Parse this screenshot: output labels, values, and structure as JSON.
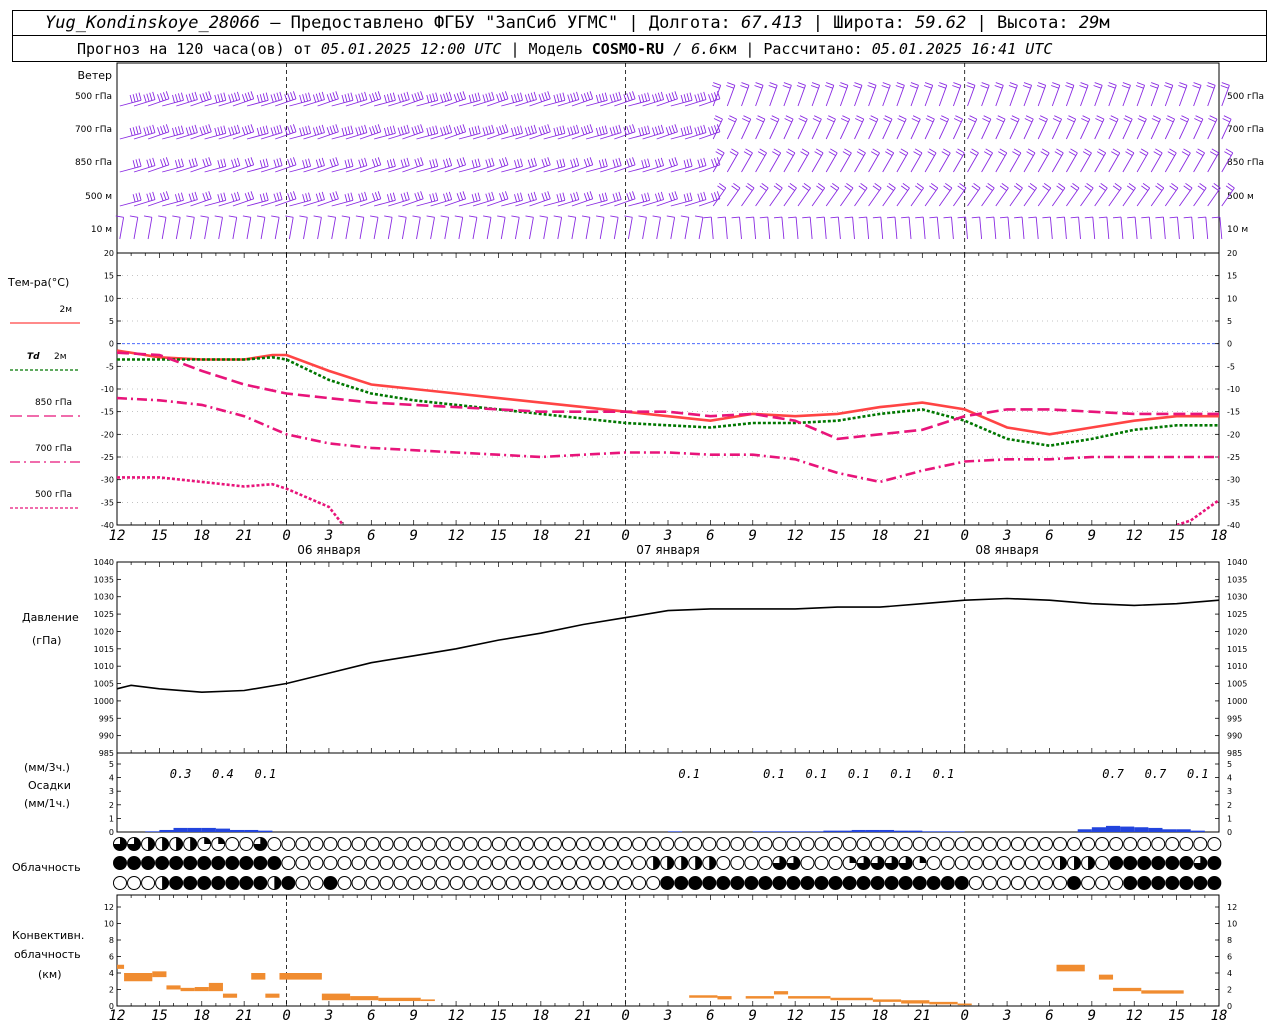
{
  "header": {
    "station": "Yug_Kondinskoye_28066",
    "provided": "– Предоставлено ФГБУ \"ЗапСиб УГМС\"",
    "lon_label": "Долгота:",
    "lon": "67.413",
    "lat_label": "Широта:",
    "lat": "59.62",
    "alt_label": "Высота:",
    "alt": "29",
    "alt_unit": "м",
    "forecast_label": "Прогноз на 120 часа(ов) от",
    "forecast_time": "05.01.2025 12:00 UTC",
    "model_label": "| Модель",
    "model": "COSMO-RU",
    "model_res": "/ 6.6",
    "model_res_unit": "км",
    "calc_label": "| Рассчитано:",
    "calc_time": "05.01.2025 16:41 UTC"
  },
  "wind": {
    "title": "Ветер",
    "levels": [
      "500 гПа",
      "700 гПа",
      "850 гПа",
      "500 м",
      "10  м"
    ],
    "color": "#8a2be2"
  },
  "temp": {
    "title": "Тем-ра(°C)",
    "legend": [
      {
        "prefix": "",
        "label": "2м",
        "color": "#ff4444",
        "dash": ""
      },
      {
        "prefix": "Td",
        "label": "2м",
        "color": "#007700",
        "dash": "3,2"
      },
      {
        "prefix": "",
        "label": "850 гПа",
        "color": "#e8147a",
        "dash": "12,5"
      },
      {
        "prefix": "",
        "label": "700 гПа",
        "color": "#e8147a",
        "dash": "10,4,2,4"
      },
      {
        "prefix": "",
        "label": "500 гПа",
        "color": "#e8147a",
        "dash": "3,2"
      }
    ],
    "ticks": [
      "20",
      "15",
      "10",
      "5",
      "0",
      "-5",
      "-10",
      "-15",
      "-20",
      "-25",
      "-30",
      "-35",
      "-40"
    ]
  },
  "x_axis": {
    "hour_labels": [
      "12",
      "15",
      "18",
      "21",
      "0",
      "3",
      "6",
      "9",
      "12",
      "15",
      "18",
      "21",
      "0",
      "3",
      "6",
      "9",
      "12",
      "15",
      "18",
      "21",
      "0",
      "3",
      "6",
      "9",
      "12",
      "15",
      "18"
    ],
    "dates": [
      "06 января",
      "07 января",
      "08 января"
    ]
  },
  "pressure": {
    "title": "Давление",
    "unit": "(гПа)",
    "ticks": [
      "1040",
      "1035",
      "1030",
      "1025",
      "1020",
      "1015",
      "1010",
      "1005",
      "1000",
      "995",
      "990",
      "985"
    ]
  },
  "precip": {
    "unit_top": "(мм/3ч.)",
    "title": "Осадки",
    "unit_bottom": "(мм/1ч.)",
    "ticks": [
      "5",
      "4",
      "3",
      "2",
      "1",
      "0"
    ],
    "labels": [
      {
        "t": 4.5,
        "text": "0.3"
      },
      {
        "t": 7.5,
        "text": "0.4"
      },
      {
        "t": 10.5,
        "text": "0.1"
      },
      {
        "t": 40.5,
        "text": "0.1"
      },
      {
        "t": 46.5,
        "text": "0.1"
      },
      {
        "t": 49.5,
        "text": "0.1"
      },
      {
        "t": 52.5,
        "text": "0.1"
      },
      {
        "t": 55.5,
        "text": "0.1"
      },
      {
        "t": 58.5,
        "text": "0.1"
      },
      {
        "t": 70.5,
        "text": "0.7"
      },
      {
        "t": 73.5,
        "text": "0.7"
      },
      {
        "t": 76.5,
        "text": "0.1"
      }
    ]
  },
  "cloud": {
    "title": "Облачность"
  },
  "conv": {
    "title1": "Конвективн.",
    "title2": "облачность",
    "unit": "(км)",
    "ticks": [
      "12",
      "10",
      "8",
      "6",
      "4",
      "2",
      "0"
    ]
  },
  "chart_data": [
    {
      "type": "line",
      "title": "Тем-ра(°C)",
      "x_unit": "hours since 05.01.2025 12:00 UTC",
      "ylim": [
        -40,
        20
      ],
      "series": [
        {
          "name": "2м",
          "x": [
            0,
            3,
            6,
            9,
            11,
            12,
            15,
            18,
            21,
            24,
            27,
            30,
            33,
            36,
            39,
            42,
            45,
            48,
            51,
            54,
            57,
            60,
            63,
            66,
            69,
            72,
            75,
            78
          ],
          "values": [
            -1.5,
            -3,
            -3.5,
            -3.5,
            -2.5,
            -2.5,
            -6,
            -9,
            -10,
            -11,
            -12,
            -13,
            -14,
            -15,
            -16,
            -17,
            -15.5,
            -16,
            -15.5,
            -14,
            -13,
            -14.5,
            -18.5,
            -20,
            -18.5,
            -17,
            -16,
            -16
          ]
        },
        {
          "name": "Td 2м",
          "x": [
            0,
            3,
            6,
            9,
            11,
            12,
            15,
            18,
            21,
            24,
            27,
            30,
            33,
            36,
            39,
            42,
            45,
            48,
            51,
            54,
            57,
            60,
            63,
            66,
            69,
            72,
            75,
            78
          ],
          "values": [
            -3.5,
            -3.5,
            -3.5,
            -3.5,
            -3,
            -3.5,
            -8,
            -11,
            -12.5,
            -13.5,
            -14.5,
            -15.5,
            -16.5,
            -17.5,
            -18,
            -18.5,
            -17.5,
            -17.5,
            -17,
            -15.5,
            -14.5,
            -17,
            -21,
            -22.5,
            -21,
            -19,
            -18,
            -18
          ]
        },
        {
          "name": "850 гПа",
          "x": [
            0,
            3,
            6,
            9,
            12,
            15,
            18,
            21,
            24,
            27,
            30,
            33,
            36,
            39,
            42,
            45,
            48,
            51,
            54,
            57,
            60,
            63,
            66,
            69,
            72,
            75,
            78
          ],
          "values": [
            -2,
            -2.5,
            -6,
            -9,
            -11,
            -12,
            -13,
            -13.5,
            -14,
            -14.5,
            -15,
            -15,
            -15,
            -15,
            -16,
            -15.5,
            -17,
            -21,
            -20,
            -19,
            -16,
            -14.5,
            -14.5,
            -15,
            -15.5,
            -15.5,
            -15.5
          ]
        },
        {
          "name": "700 гПа",
          "x": [
            0,
            3,
            6,
            9,
            12,
            15,
            18,
            21,
            24,
            27,
            30,
            33,
            36,
            39,
            42,
            45,
            48,
            51,
            54,
            57,
            60,
            63,
            66,
            69,
            72,
            75,
            78
          ],
          "values": [
            -12,
            -12.5,
            -13.5,
            -16,
            -20,
            -22,
            -23,
            -23.5,
            -24,
            -24.5,
            -25,
            -24.5,
            -24,
            -24,
            -24.5,
            -24.5,
            -25.5,
            -28.5,
            -30.5,
            -28,
            -26,
            -25.5,
            -25.5,
            -25,
            -25,
            -25,
            -25
          ]
        },
        {
          "name": "500 гПа",
          "x": [
            0,
            3,
            6,
            9,
            11,
            12,
            15,
            16
          ],
          "values": [
            -29.5,
            -29.5,
            -30.5,
            -31.5,
            -31,
            -32,
            -36,
            -40
          ]
        },
        {
          "name": "500 гПа",
          "x": [
            75,
            76,
            78
          ],
          "values": [
            -40,
            -39,
            -34.5
          ]
        }
      ]
    },
    {
      "type": "line",
      "title": "Давление",
      "x_unit": "hours since 05.01.2025 12:00 UTC",
      "ylim": [
        985,
        1040
      ],
      "series": [
        {
          "name": "Давление",
          "x": [
            0,
            1,
            3,
            6,
            9,
            12,
            15,
            18,
            21,
            24,
            27,
            30,
            33,
            36,
            39,
            42,
            45,
            48,
            51,
            54,
            57,
            60,
            63,
            66,
            69,
            72,
            75,
            78
          ],
          "values": [
            1003.5,
            1004.5,
            1003.5,
            1002.5,
            1003,
            1005,
            1008,
            1011,
            1013,
            1015,
            1017.5,
            1019.5,
            1022,
            1024,
            1026,
            1026.5,
            1026.5,
            1026.5,
            1027,
            1027,
            1028,
            1029,
            1029.5,
            1029,
            1028,
            1027.5,
            1028,
            1029
          ]
        }
      ]
    },
    {
      "type": "bar",
      "title": "Осадки",
      "x_unit": "hours since 05.01.2025 12:00 UTC",
      "ylim": [
        0,
        5
      ],
      "series": [
        {
          "name": "Осадки (мм/1ч.)",
          "x": [
            3,
            4,
            5,
            6,
            7,
            8,
            9,
            10,
            11,
            40,
            46,
            47,
            48,
            49,
            50,
            51,
            52,
            53,
            54,
            55,
            56,
            57,
            58,
            59,
            60,
            69,
            70,
            71,
            72,
            73,
            74,
            75,
            76,
            77
          ],
          "values": [
            0.05,
            0.15,
            0.3,
            0.3,
            0.3,
            0.25,
            0.15,
            0.15,
            0.1,
            0.05,
            0.05,
            0.05,
            0.05,
            0.05,
            0.05,
            0.1,
            0.1,
            0.15,
            0.15,
            0.15,
            0.1,
            0.1,
            0.05,
            0.05,
            0.05,
            0.2,
            0.35,
            0.45,
            0.4,
            0.35,
            0.3,
            0.2,
            0.2,
            0.1
          ]
        }
      ]
    },
    {
      "type": "heatmap",
      "title": "Облачность",
      "x_unit": "hours since 05.01.2025 12:00 UTC",
      "rows": [
        "upper",
        "middle",
        "lower"
      ],
      "values_fraction": {
        "upper": [
          0.75,
          0.75,
          0.5,
          0.5,
          0.5,
          0.5,
          0.25,
          0.25,
          0,
          0,
          0.75,
          0,
          0,
          0,
          0,
          0,
          0,
          0,
          0,
          0,
          0,
          0,
          0,
          0,
          0,
          0,
          0,
          0,
          0,
          0,
          0,
          0,
          0,
          0,
          0,
          0,
          0,
          0,
          0,
          0,
          0,
          0,
          0,
          0,
          0,
          0,
          0,
          0,
          0,
          0,
          0,
          0,
          0,
          0,
          0,
          0,
          0,
          0,
          0,
          0,
          0,
          0,
          0,
          0,
          0,
          0,
          0,
          0,
          0,
          0,
          0,
          0,
          0,
          0,
          0,
          0,
          0,
          0,
          0
        ],
        "middle": [
          1,
          1,
          1,
          1,
          1,
          1,
          1,
          1,
          1,
          1,
          1,
          1,
          0,
          0,
          0,
          0,
          0,
          0,
          0,
          0,
          0,
          0,
          0,
          0,
          0,
          0,
          0,
          0,
          0,
          0,
          0,
          0,
          0,
          0,
          0,
          0,
          0,
          0,
          0.5,
          0.5,
          0.5,
          0.5,
          0.5,
          0,
          0,
          0,
          0,
          0.75,
          0.75,
          0,
          0,
          0,
          0.25,
          0.75,
          0.75,
          0.75,
          0.75,
          0.25,
          0,
          0,
          0,
          0,
          0,
          0,
          0,
          0,
          0,
          0.5,
          0.5,
          0.5,
          0,
          1,
          1,
          1,
          1,
          1,
          1,
          0.75,
          1
        ],
        "lower": [
          0,
          0,
          0,
          0.5,
          1,
          1,
          1,
          1,
          1,
          1,
          1,
          0.5,
          1,
          0,
          0,
          1,
          0,
          0,
          0,
          0,
          0,
          0,
          0,
          0,
          0,
          0,
          0,
          0,
          0,
          0,
          0,
          0,
          0,
          0,
          0,
          0,
          0,
          0,
          0,
          1,
          1,
          1,
          1,
          1,
          1,
          1,
          1,
          1,
          1,
          1,
          1,
          1,
          1,
          1,
          1,
          1,
          1,
          1,
          1,
          1,
          1,
          0,
          0,
          0,
          0,
          0,
          0,
          0,
          1,
          0,
          0,
          0,
          1,
          1,
          1,
          1,
          1,
          1,
          1
        ]
      }
    },
    {
      "type": "bar",
      "title": "Конвективн. облачность",
      "x_unit": "hours since 05.01.2025 12:00 UTC",
      "ylim": [
        0,
        14
      ],
      "segments_km": [
        {
          "x0": 0,
          "x1": 0.5,
          "base": 4.5,
          "top": 5
        },
        {
          "x0": 0.5,
          "x1": 2.5,
          "base": 3,
          "top": 4
        },
        {
          "x0": 2.5,
          "x1": 3.5,
          "base": 3.5,
          "top": 4.2
        },
        {
          "x0": 3.5,
          "x1": 4.5,
          "base": 2,
          "top": 2.5
        },
        {
          "x0": 4.5,
          "x1": 5.5,
          "base": 1.8,
          "top": 2.2
        },
        {
          "x0": 5.5,
          "x1": 6.5,
          "base": 1.8,
          "top": 2.3
        },
        {
          "x0": 6.5,
          "x1": 7.5,
          "base": 1.8,
          "top": 2.8
        },
        {
          "x0": 7.5,
          "x1": 8.5,
          "base": 1,
          "top": 1.5
        },
        {
          "x0": 9.5,
          "x1": 10.5,
          "base": 3.2,
          "top": 4
        },
        {
          "x0": 10.5,
          "x1": 11.5,
          "base": 1,
          "top": 1.5
        },
        {
          "x0": 11.5,
          "x1": 14.5,
          "base": 3.2,
          "top": 4
        },
        {
          "x0": 14.5,
          "x1": 16.5,
          "base": 0.7,
          "top": 1.5
        },
        {
          "x0": 16.5,
          "x1": 18.5,
          "base": 0.7,
          "top": 1.2
        },
        {
          "x0": 18.5,
          "x1": 21.5,
          "base": 0.6,
          "top": 1
        },
        {
          "x0": 21.5,
          "x1": 22.5,
          "base": 0.6,
          "top": 0.8
        },
        {
          "x0": 40.5,
          "x1": 42.5,
          "base": 1,
          "top": 1.3
        },
        {
          "x0": 42.5,
          "x1": 43.5,
          "base": 0.8,
          "top": 1.2
        },
        {
          "x0": 44.5,
          "x1": 46.5,
          "base": 0.9,
          "top": 1.2
        },
        {
          "x0": 46.5,
          "x1": 47.5,
          "base": 1.4,
          "top": 1.8
        },
        {
          "x0": 47.5,
          "x1": 50.5,
          "base": 0.9,
          "top": 1.2
        },
        {
          "x0": 50.5,
          "x1": 53.5,
          "base": 0.7,
          "top": 1
        },
        {
          "x0": 53.5,
          "x1": 55.5,
          "base": 0.5,
          "top": 0.8
        },
        {
          "x0": 55.5,
          "x1": 57.5,
          "base": 0.3,
          "top": 0.7
        },
        {
          "x0": 57.5,
          "x1": 59.5,
          "base": 0.2,
          "top": 0.5
        },
        {
          "x0": 59.5,
          "x1": 60.5,
          "base": 0.1,
          "top": 0.3
        },
        {
          "x0": 66.5,
          "x1": 68.5,
          "base": 4.2,
          "top": 5
        },
        {
          "x0": 69.5,
          "x1": 70.5,
          "base": 3.2,
          "top": 3.8
        },
        {
          "x0": 70.5,
          "x1": 72.5,
          "base": 1.8,
          "top": 2.2
        },
        {
          "x0": 72.5,
          "x1": 75.5,
          "base": 1.5,
          "top": 1.9
        }
      ]
    }
  ]
}
